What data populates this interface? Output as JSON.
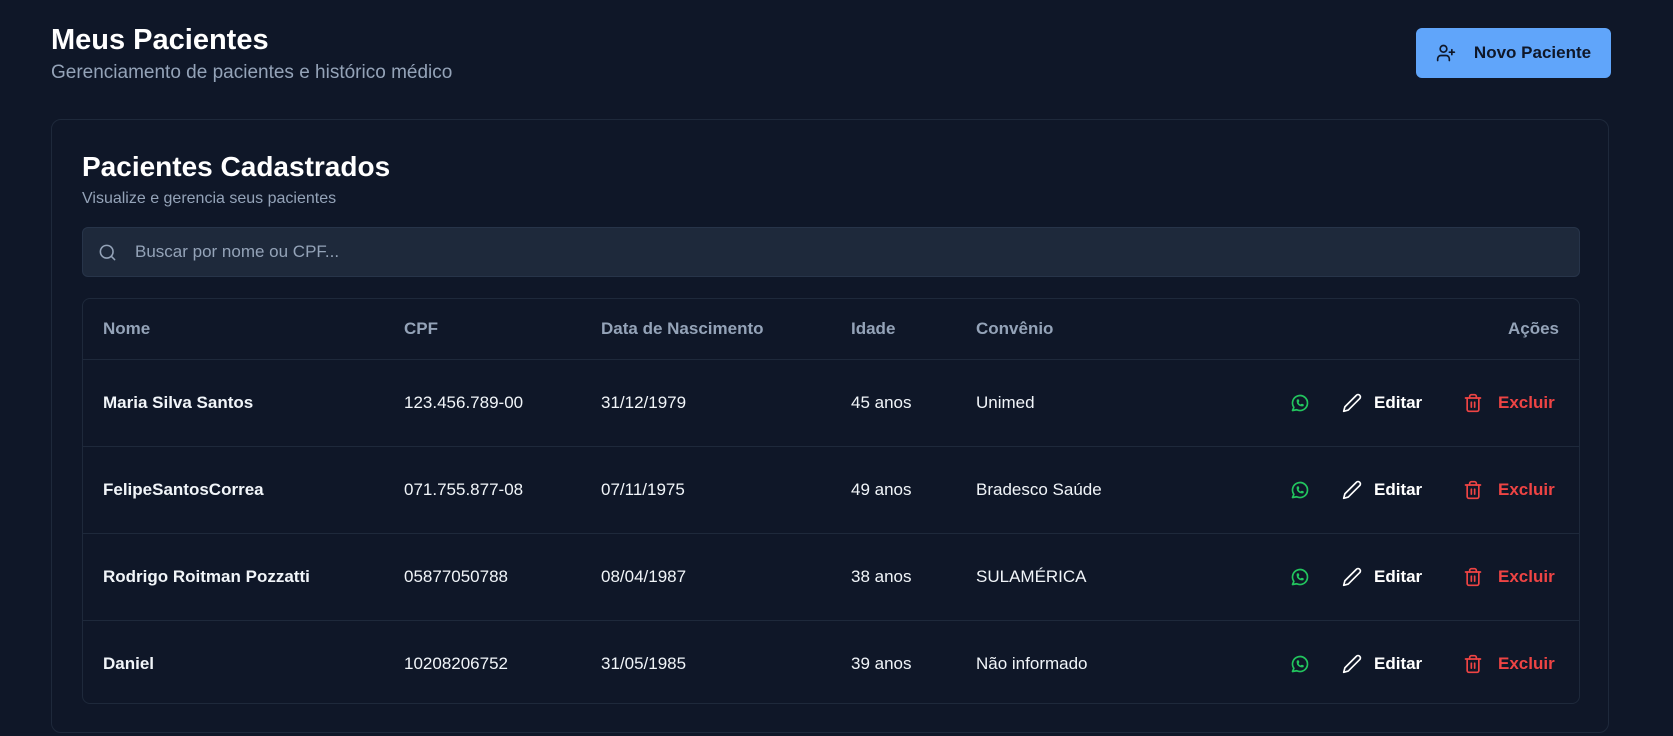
{
  "header": {
    "title": "Meus Pacientes",
    "subtitle": "Gerenciamento de pacientes e histórico médico",
    "new_button_label": "Novo Paciente"
  },
  "card": {
    "title": "Pacientes Cadastrados",
    "subtitle": "Visualize e gerencia seus pacientes"
  },
  "search": {
    "placeholder": "Buscar por nome ou CPF...",
    "value": ""
  },
  "table": {
    "columns": {
      "name": "Nome",
      "cpf": "CPF",
      "birth": "Data de Nascimento",
      "age": "Idade",
      "insurance": "Convênio",
      "actions": "Ações"
    },
    "edit_label": "Editar",
    "delete_label": "Excluir",
    "rows": [
      {
        "name": "Maria Silva Santos",
        "cpf": "123.456.789-00",
        "birth": "31/12/1979",
        "age": "45 anos",
        "insurance": "Unimed"
      },
      {
        "name": "FelipeSantosCorrea",
        "cpf": "071.755.877-08",
        "birth": "07/11/1975",
        "age": "49 anos",
        "insurance": "Bradesco Saúde"
      },
      {
        "name": "Rodrigo Roitman Pozzatti",
        "cpf": "05877050788",
        "birth": "08/04/1987",
        "age": "38 anos",
        "insurance": "SULAMÉRICA"
      },
      {
        "name": "Daniel",
        "cpf": "10208206752",
        "birth": "31/05/1985",
        "age": "39 anos",
        "insurance": "Não informado"
      }
    ]
  },
  "colors": {
    "background": "#0f1728",
    "accent": "#60a5fa",
    "whatsapp": "#22c55e",
    "danger": "#ef4444",
    "muted_text": "#94a3b8"
  },
  "icons": {
    "new_button": "user-plus-icon",
    "search": "search-icon",
    "whatsapp": "whatsapp-icon",
    "edit": "pencil-icon",
    "delete": "trash-icon"
  }
}
